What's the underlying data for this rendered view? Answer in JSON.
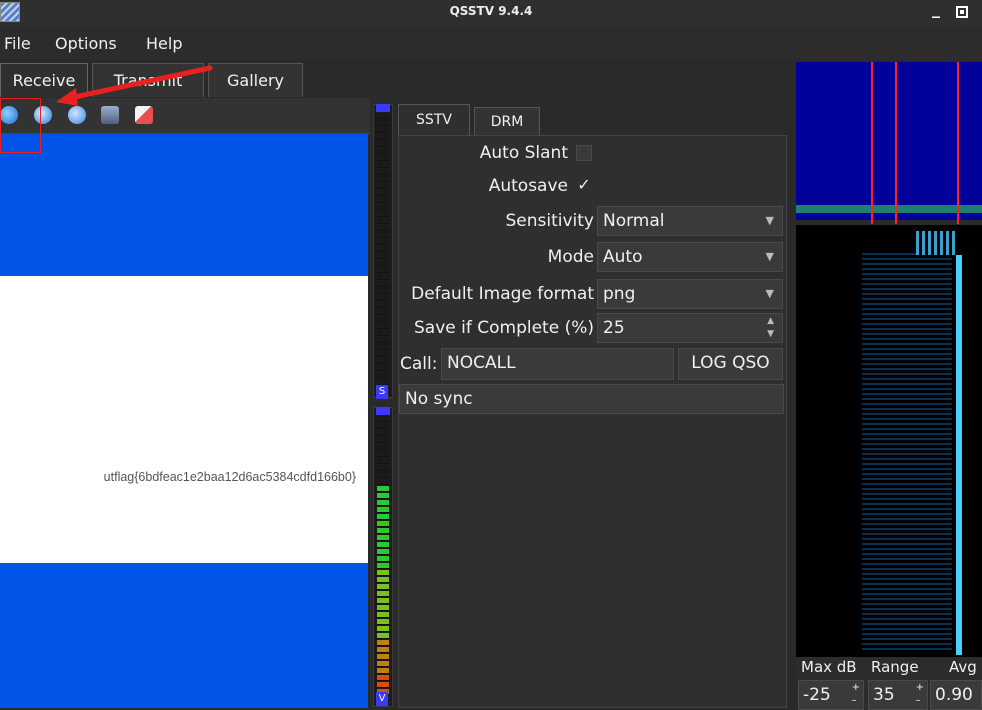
{
  "window": {
    "title": "QSSTV 9.4.4",
    "minimize": "_"
  },
  "menu": [
    "File",
    "Options",
    "Help"
  ],
  "tabs": [
    "Receive",
    "Transmit",
    "Gallery"
  ],
  "toolbar": {
    "icons": [
      "start-icon",
      "stop-icon",
      "resync-icon",
      "save-icon",
      "erase-icon"
    ]
  },
  "image": {
    "text": "utflag{6bdfeac1e2baa12d6ac5384cdfd166b0}"
  },
  "meters": {
    "top_label": "S",
    "bottom_label": "V"
  },
  "settings": {
    "tabs": [
      "SSTV",
      "DRM"
    ],
    "auto_slant": {
      "label": "Auto Slant",
      "checked": false
    },
    "autosave": {
      "label": "Autosave",
      "checked": true,
      "mark": "✓"
    },
    "sensitivity": {
      "label": "Sensitivity",
      "value": "Normal"
    },
    "mode": {
      "label": "Mode",
      "value": "Auto"
    },
    "image_format": {
      "label": "Default Image format",
      "value": "png"
    },
    "save_if_complete": {
      "label": "Save if Complete (%)",
      "value": "25"
    },
    "call": {
      "label": "Call:",
      "value": "NOCALL"
    },
    "log_qso": "LOG QSO",
    "status": "No sync"
  },
  "waterfall": {
    "max_db": {
      "label": "Max dB",
      "value": "-25"
    },
    "range": {
      "label": "Range",
      "value": "35"
    },
    "avg": {
      "label": "Avg",
      "value": "0.90"
    }
  },
  "colors": {
    "image_blue": "#0055e8",
    "accent_red": "#e82020",
    "spectrum_blue": "#02029a"
  }
}
